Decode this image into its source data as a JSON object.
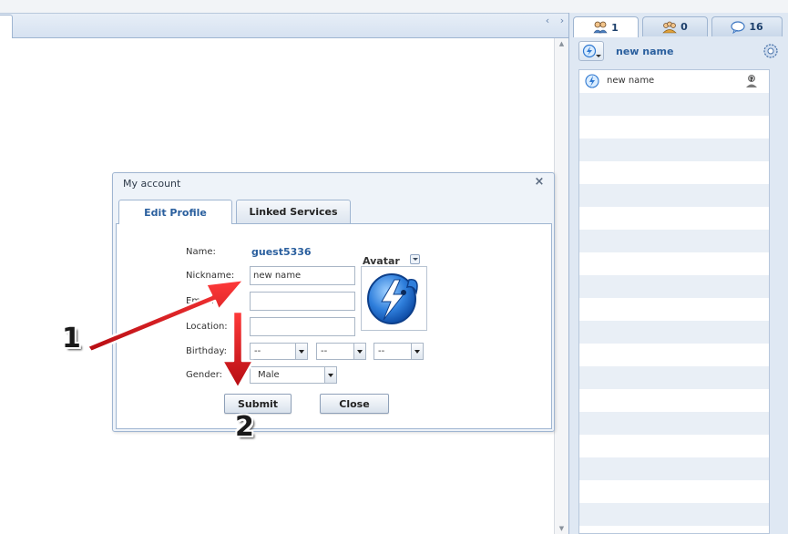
{
  "main": {
    "nav_prev": "‹",
    "nav_next": "›"
  },
  "right_panel": {
    "tabs": [
      {
        "icon": "users-icon",
        "count": "1"
      },
      {
        "icon": "group-icon",
        "count": "0"
      },
      {
        "icon": "chat-bubble-icon",
        "count": "16"
      }
    ],
    "toolbar_name": "new name",
    "users": [
      {
        "name": "new name"
      }
    ]
  },
  "dialog": {
    "title": "My account",
    "close": "×",
    "tabs": {
      "edit_profile": "Edit Profile",
      "linked_services": "Linked Services"
    },
    "form": {
      "name_label": "Name:",
      "name_value": "guest5336",
      "nickname_label": "Nickname:",
      "nickname_value": "new name",
      "email_label": "Email:",
      "email_value": "",
      "location_label": "Location:",
      "location_value": "",
      "birthday_label": "Birthday:",
      "birthday_day": "--",
      "birthday_month": "--",
      "birthday_year": "--",
      "gender_label": "Gender:",
      "gender_value": "Male",
      "avatar_label": "Avatar"
    },
    "buttons": {
      "submit": "Submit",
      "close": "Close"
    }
  },
  "annotations": {
    "step1": "1",
    "step2": "2"
  },
  "colors": {
    "accent": "#2a5f9e",
    "arrow": "#d8141b",
    "panel_bg": "#dfe8f3"
  }
}
